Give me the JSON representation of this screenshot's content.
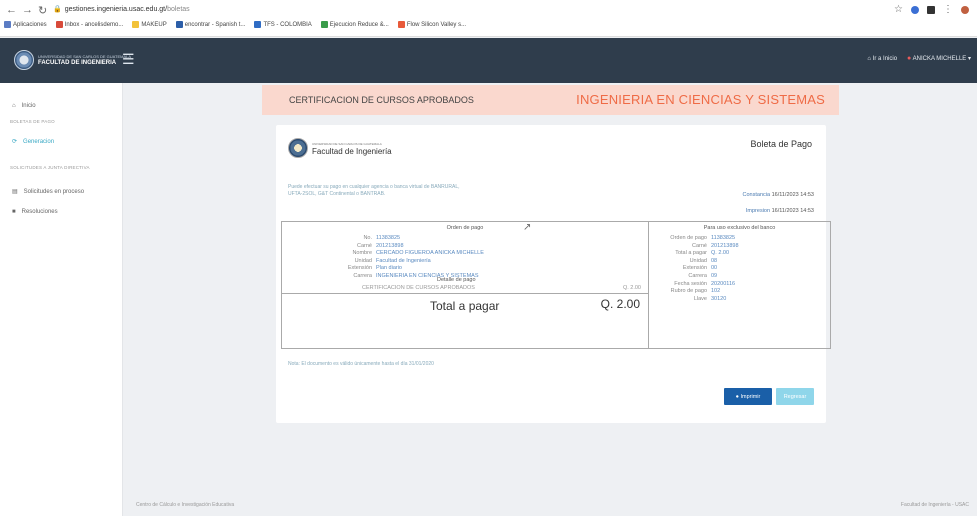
{
  "browser": {
    "url_prefix": "gestiones.ingenieria.usac.edu.gt/",
    "url_path": "boletas",
    "bookmarks": [
      {
        "label": "Aplicaciones",
        "color": "#5b7cc4"
      },
      {
        "label": "Inbox - ancelisdemo...",
        "color": "#d84a3a"
      },
      {
        "label": "MAKEUP",
        "color": "#f2c23a"
      },
      {
        "label": "encontrar - Spanish t...",
        "color": "#2c5ea8"
      },
      {
        "label": "TFS - COLOMBIA",
        "color": "#2f6cc4"
      },
      {
        "label": "Ejecucion Reduce &...",
        "color": "#3a9c4a"
      },
      {
        "label": "Flow Silicon Valley s...",
        "color": "#e85a3a"
      }
    ]
  },
  "topbar": {
    "logo_small": "UNIVERSIDAD DE SAN CARLOS DE GUATEMALA",
    "logo_text": "FACULTAD DE INGENIERIA",
    "home_link": "Ir a Inicio",
    "user": "ANICKA MICHELLE"
  },
  "sidebar": {
    "items": [
      {
        "label": "Inicio",
        "icon": "home-icon",
        "type": "item"
      },
      {
        "label": "BOLETAS DE PAGO",
        "type": "header"
      },
      {
        "label": "Generacion",
        "icon": "refresh-icon",
        "type": "active"
      },
      {
        "label": "SOLICITUDES A JUNTA DIRECTIVA",
        "type": "header"
      },
      {
        "label": "Solicitudes en proceso",
        "icon": "list-icon",
        "type": "item"
      },
      {
        "label": "Resoluciones",
        "icon": "doc-icon",
        "type": "item"
      }
    ]
  },
  "main": {
    "title_left": "CERTIFICACION DE CURSOS APROBADOS",
    "title_right": "INGENIERIA EN CIENCIAS Y SISTEMAS",
    "card": {
      "logo_small": "UNIVERSIDAD DE SAN CARLOS DE GUATEMALA",
      "logo_text": "Facultad de Ingeniería",
      "boleta_title": "Boleta de Pago",
      "note_line1": "Puede efectuar su pago en cualquier agencia o banca virtual de BANRURAL,",
      "note_line2": "UFTA-2SOL, G&T Continental o BANTRAB.",
      "constancia_label": "Constancia",
      "constancia_value": "16/11/2023 14:53",
      "impresion_label": "Impresion",
      "impresion_value": "16/11/2023 14:53",
      "orden_title": "Orden de pago",
      "orden": [
        {
          "k": "No.",
          "v": "11383825"
        },
        {
          "k": "Carné",
          "v": "201213898"
        },
        {
          "k": "Nombre",
          "v": "CERCADO FIGUEROA ANICKA MICHELLE"
        },
        {
          "k": "Unidad",
          "v": "Facultad de Ingeniería"
        },
        {
          "k": "Extensión",
          "v": "Plan diario"
        },
        {
          "k": "Carrera",
          "v": "INGENIERIA EN CIENCIAS Y SISTEMAS"
        }
      ],
      "detalle_title": "Detalle de pago",
      "detalle_item": "CERTIFICACION DE CURSOS APROBADOS",
      "detalle_value": "Q. 2.00",
      "total_label": "Total a pagar",
      "total_value": "Q. 2.00",
      "banco_title": "Para uso exclusivo del banco",
      "banco": [
        {
          "k": "Orden de pago",
          "v": "11383825"
        },
        {
          "k": "Carné",
          "v": "201213898"
        },
        {
          "k": "Total a pagar",
          "v": "Q. 2.00"
        },
        {
          "k": "Unidad",
          "v": "08"
        },
        {
          "k": "Extensión",
          "v": "00"
        },
        {
          "k": "Carrera",
          "v": "09"
        },
        {
          "k": "Fecha sesión",
          "v": "20200116"
        },
        {
          "k": "Rubro de pago",
          "v": "102"
        },
        {
          "k": "Llave",
          "v": "30120"
        }
      ],
      "validity": "Nota: El documento es válido únicamente hasta el día 31/01/2020",
      "print_label": "Imprimir",
      "back_label": "Regresar"
    }
  },
  "footer": {
    "left": "Centro de Cálculo e Investigación Educativa",
    "right": "Facultad de Ingeniería - USAC"
  }
}
